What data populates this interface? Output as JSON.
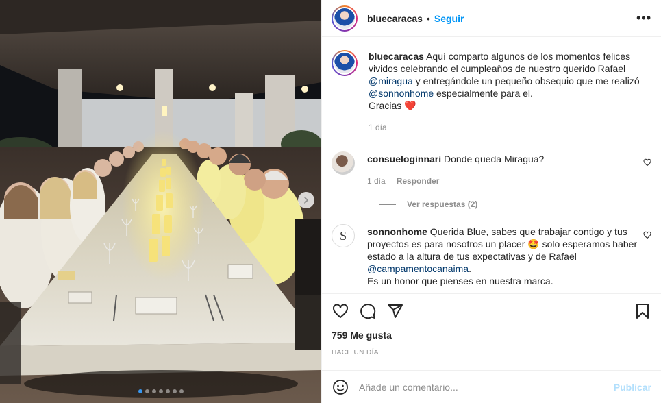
{
  "post": {
    "image_alt": "Cena nocturna en una mesa larga con velas",
    "carousel_dots": 7,
    "carousel_active": 0
  },
  "header": {
    "username": "bluecaracas",
    "separator": "•",
    "follow_label": "Seguir",
    "more_label": "•••"
  },
  "caption": {
    "username": "bluecaracas",
    "text_1": "Aquí comparto algunos de los momentos felices vividos celebrando el cumpleaños de nuestro querido Rafael ",
    "mention_1": "@miragua",
    "text_2": " y entregándole un pequeño obsequio que me realizó ",
    "mention_2": "@sonnonhome",
    "text_3": " especialmente para el.",
    "thanks": "Gracias ",
    "heart_emoji": "❤️",
    "time": "1 día"
  },
  "comments": [
    {
      "username": "consueloginnari",
      "text": "Donde queda Miragua?",
      "time": "1 día",
      "reply_label": "Responder",
      "view_replies": "Ver respuestas (2)"
    },
    {
      "username": "sonnonhome",
      "text_1": "Querida Blue, sabes que trabajar contigo y tus proyectos es para nosotros un placer ",
      "emoji": "🤩",
      "text_2": " solo esperamos haber estado a la altura de tus expectativas y de Rafael ",
      "mention": "@campamentocanaima",
      "text_3": ".",
      "text_4": "Es un honor que pienses en nuestra marca.",
      "avatar_letter": "S"
    }
  ],
  "actions": {
    "likes": "759 Me gusta",
    "date": "HACE UN DÍA"
  },
  "composer": {
    "placeholder": "Añade un comentario...",
    "publish_label": "Publicar"
  },
  "colors": {
    "accent": "#0095f6",
    "mention": "#00376b",
    "muted": "#8e8e8e",
    "publish_disabled": "#b2dffc",
    "candle": "#f6e27a"
  }
}
